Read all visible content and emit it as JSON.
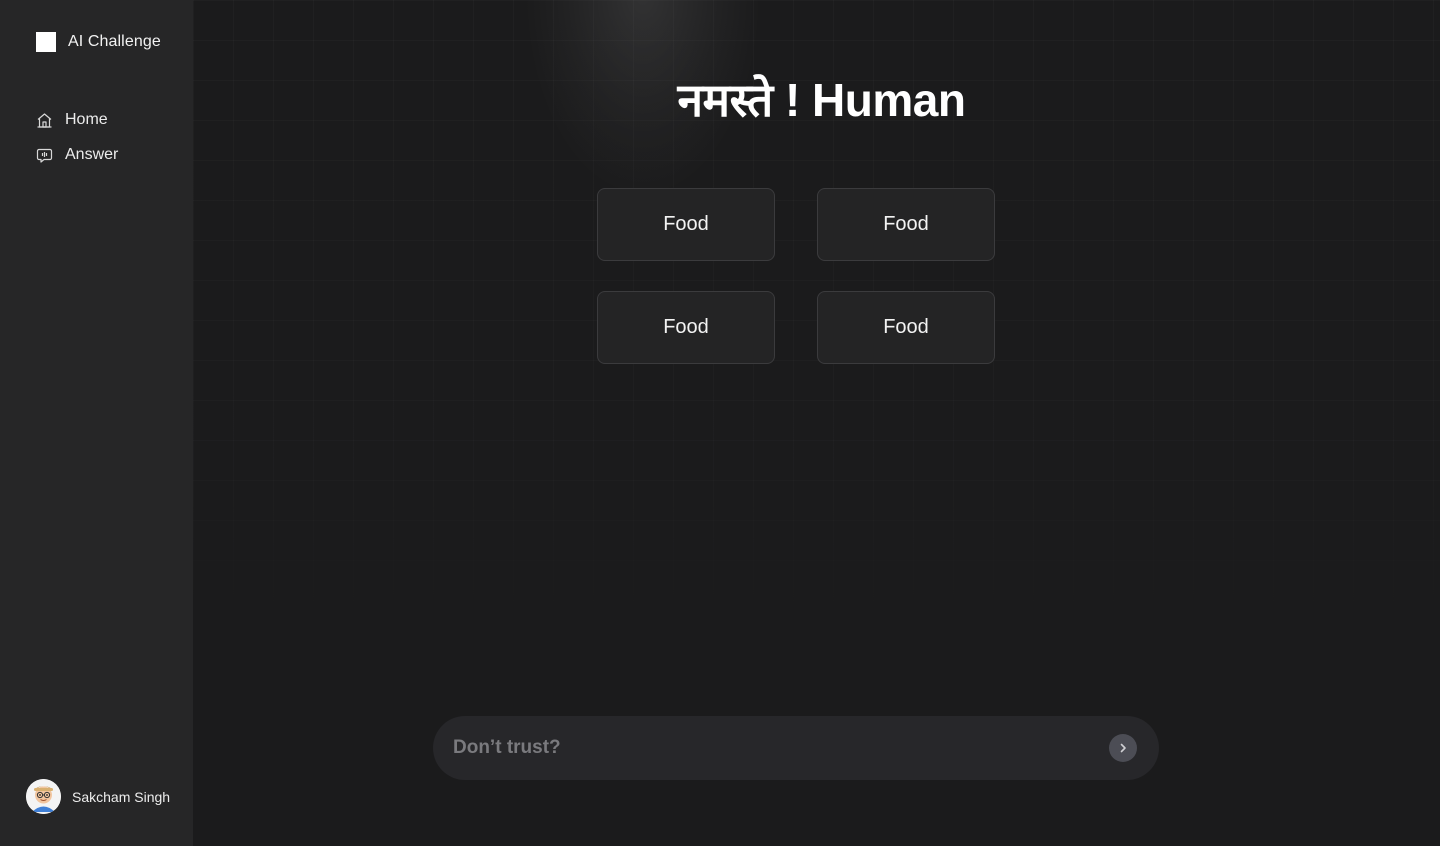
{
  "app": {
    "brand_name": "AI Challenge",
    "brand_logo": "square-logo-icon"
  },
  "sidebar": {
    "items": [
      {
        "label": "Home",
        "icon": "home-icon"
      },
      {
        "label": "Answer",
        "icon": "chat-bubble-icon"
      }
    ],
    "user": {
      "name": "Sakcham Singh",
      "avatar": "avatar-icon"
    }
  },
  "main": {
    "greeting": "नमस्ते ! Human",
    "cards": [
      {
        "label": "Food"
      },
      {
        "label": "Food"
      },
      {
        "label": "Food"
      },
      {
        "label": "Food"
      }
    ],
    "input": {
      "placeholder": "Don’t trust?",
      "value": ""
    },
    "send_icon": "chevron-right-icon"
  },
  "colors": {
    "sidebar_bg": "#262627",
    "main_bg": "#1b1b1c",
    "card_bg": "#242425",
    "card_border": "#3b3b3d",
    "input_bg": "#27272a",
    "send_button_bg": "#4c4d55"
  }
}
